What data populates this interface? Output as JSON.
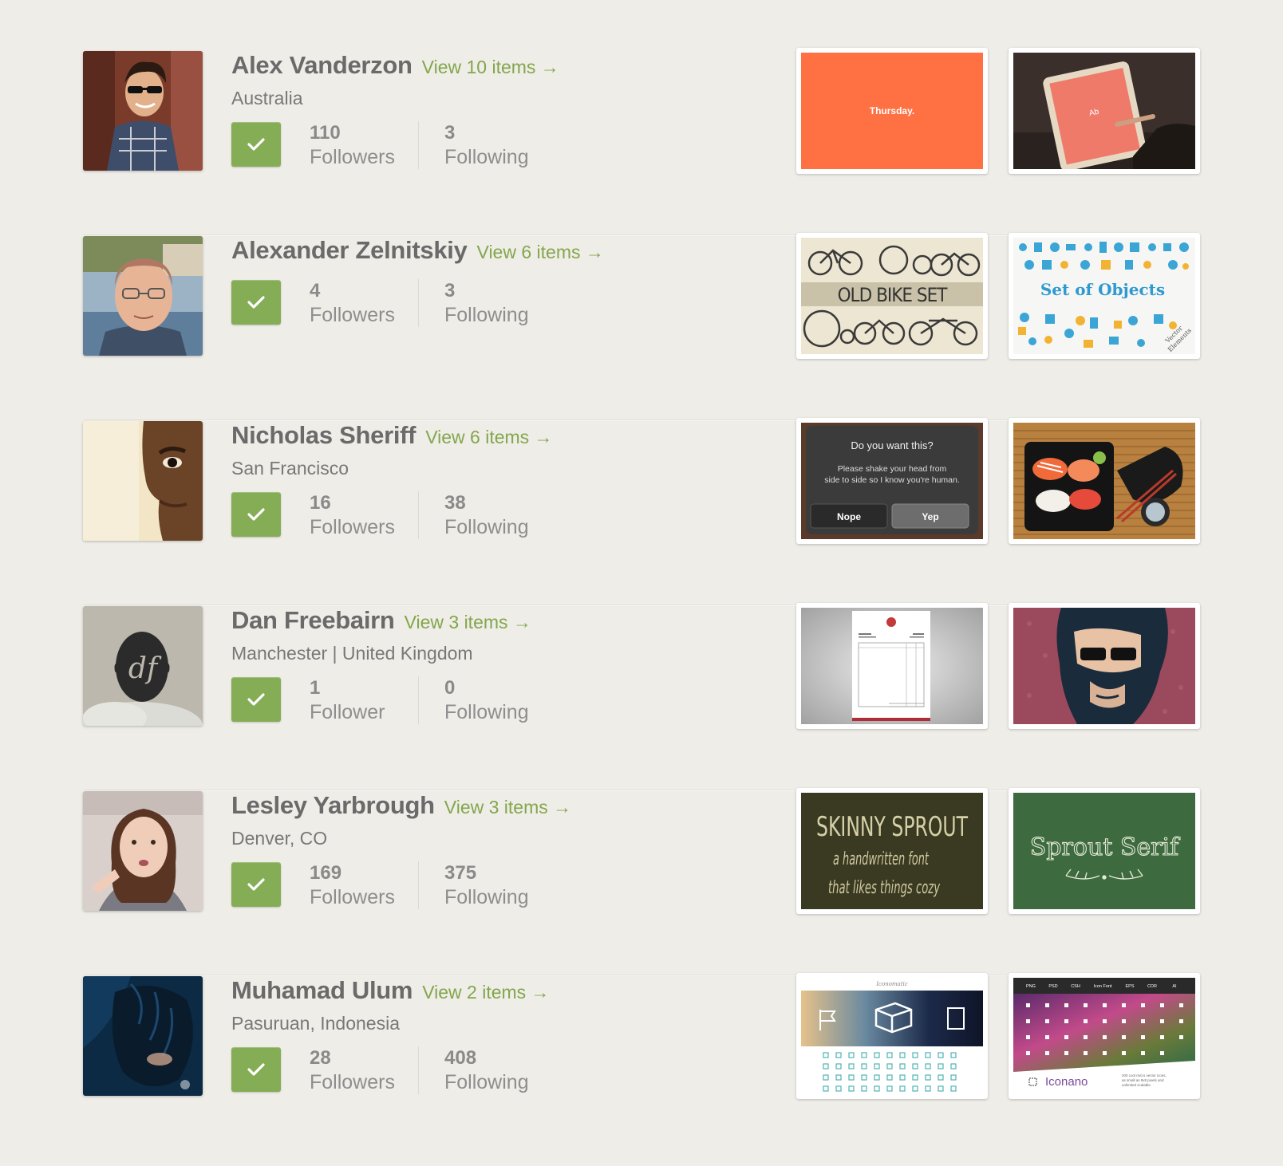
{
  "colors": {
    "accent": "#83a64c",
    "follow_button": "#85ad55",
    "background": "#efede8"
  },
  "users": [
    {
      "name": "Alex Vanderzon",
      "view_link": "View 10 items →",
      "location": "Australia",
      "followers_count": "110",
      "followers_label": "Followers",
      "following_count": "3",
      "following_label": "Following",
      "thumb1_text": "Thursday."
    },
    {
      "name": "Alexander Zelnitskiy",
      "view_link": "View 6 items →",
      "location": "",
      "followers_count": "4",
      "followers_label": "Followers",
      "following_count": "3",
      "following_label": "Following",
      "thumb1_text": "OLD BIKE SET",
      "thumb2_text": "Set of Objects",
      "thumb2_sub1": "Vector",
      "thumb2_sub2": "Elements"
    },
    {
      "name": "Nicholas Sheriff",
      "view_link": "View 6 items →",
      "location": "San Francisco",
      "followers_count": "16",
      "followers_label": "Followers",
      "following_count": "38",
      "following_label": "Following",
      "dialog_title": "Do you want this?",
      "dialog_line1": "Please shake your head from",
      "dialog_line2": "side to side so I know you're human.",
      "dialog_no": "Nope",
      "dialog_yes": "Yep"
    },
    {
      "name": "Dan Freebairn",
      "view_link": "View 3 items →",
      "location": "Manchester | United Kingdom",
      "followers_count": "1",
      "followers_label": "Follower",
      "following_count": "0",
      "following_label": "Following",
      "avatar_text": "df"
    },
    {
      "name": "Lesley Yarbrough",
      "view_link": "View 3 items →",
      "location": "Denver, CO",
      "followers_count": "169",
      "followers_label": "Followers",
      "following_count": "375",
      "following_label": "Following",
      "thumb1_line1": "SKINNY SPROUT",
      "thumb1_line2": "a handwritten font",
      "thumb1_line3": "that likes things cozy",
      "thumb2_text": "Sprout Serif"
    },
    {
      "name": "Muhamad Ulum",
      "view_link": "View 2 items →",
      "location": "Pasuruan, Indonesia",
      "followers_count": "28",
      "followers_label": "Followers",
      "following_count": "408",
      "following_label": "Following",
      "thumb1_header": "Iconomatic",
      "thumb2_tabs": [
        "PNG",
        "PSD",
        "CSH",
        "Icon Font",
        "EPS",
        "CDR",
        "AI"
      ],
      "thumb2_brand": "Iconano",
      "thumb2_desc1": "200 cool micro vector icons,",
      "thumb2_desc2": "as small as 8x8 pixels and",
      "thumb2_desc3": "unlimited scalable."
    }
  ]
}
